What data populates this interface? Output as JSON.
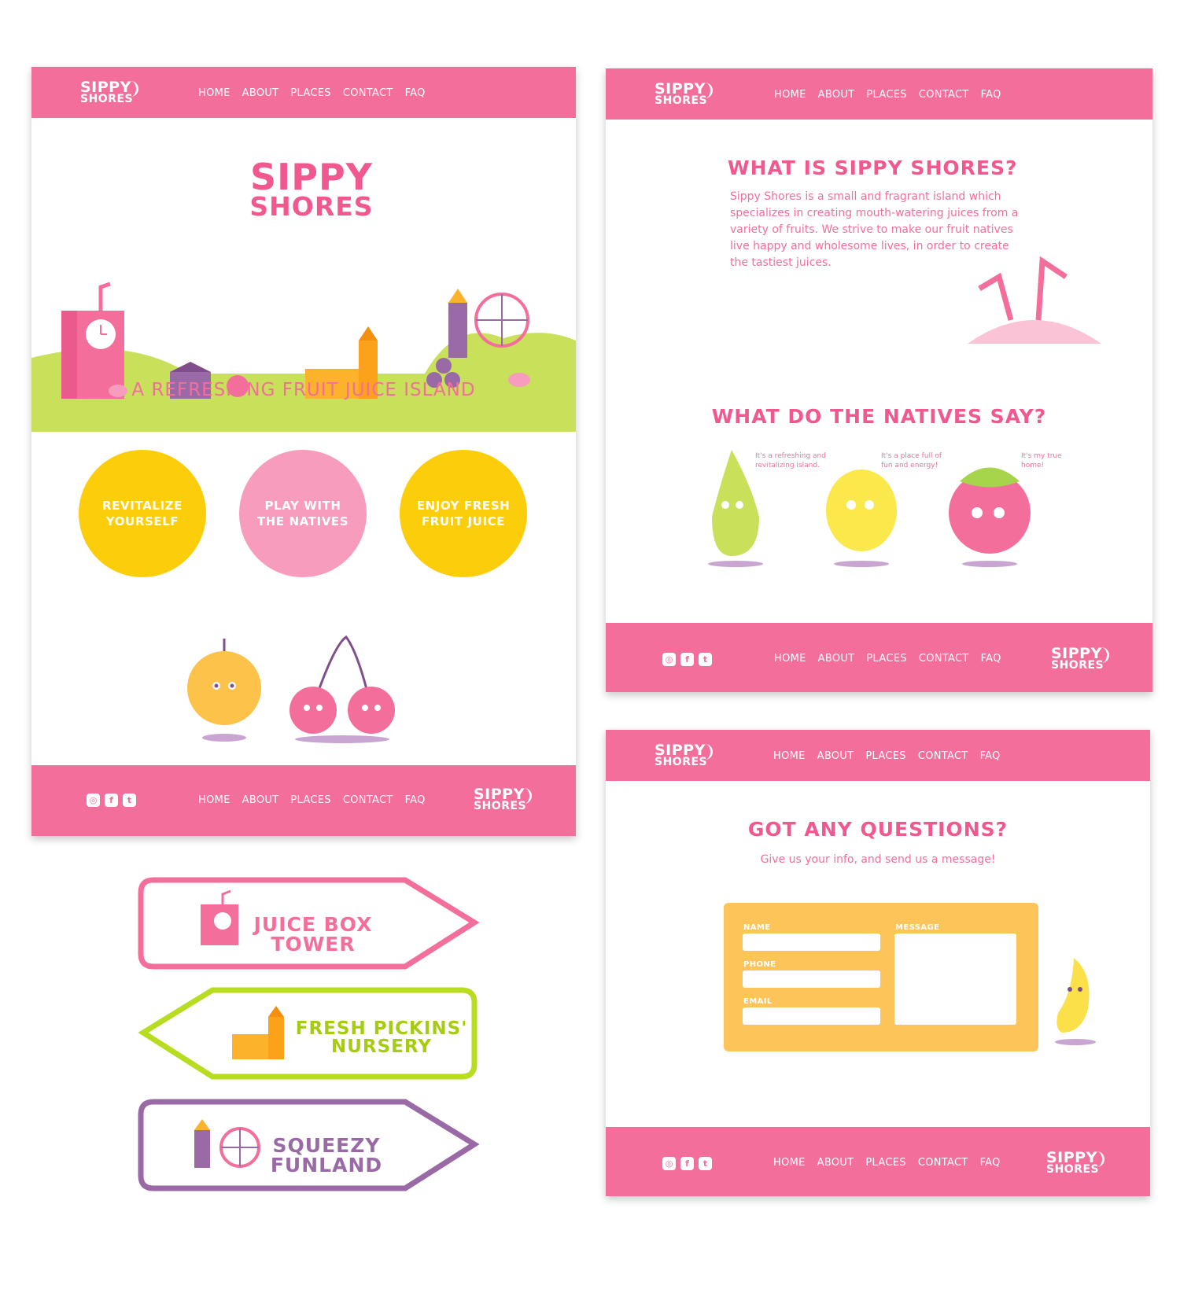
{
  "brand": {
    "line1": "SIPPY",
    "line2": "SHORES"
  },
  "nav": [
    "HOME",
    "ABOUT",
    "PLACES",
    "CONTACT",
    "FAQ"
  ],
  "social": [
    "instagram-icon",
    "facebook-icon",
    "twitter-icon"
  ],
  "social_glyphs": {
    "instagram": "◎",
    "facebook": "f",
    "twitter": "t"
  },
  "home": {
    "tagline": "A REFRESHING FRUIT JUICE ISLAND",
    "circles": [
      {
        "label": "REVITALIZE YOURSELF",
        "color": "#fccd0a"
      },
      {
        "label": "PLAY WITH THE NATIVES",
        "color": "#f79cbc"
      },
      {
        "label": "ENJOY FRESH FRUIT JUICE",
        "color": "#fccd0a"
      }
    ]
  },
  "about": {
    "title": "WHAT IS SIPPY SHORES?",
    "body": "Sippy Shores is a small and fragrant island which specializes in creating mouth-watering juices from a variety of fruits. We strive to make our fruit natives live happy and wholesome lives, in order to create the tastiest juices.",
    "natives_title": "WHAT DO THE NATIVES SAY?",
    "quotes": [
      "It's a refreshing and revitalizing island.",
      "It's a place full of fun and energy!",
      "It's my true home!"
    ]
  },
  "contact": {
    "title": "GOT ANY QUESTIONS?",
    "subtitle": "Give us your info, and send us a message!",
    "labels": {
      "name": "NAME",
      "phone": "PHONE",
      "email": "EMAIL",
      "message": "MESSAGE"
    }
  },
  "signs": [
    {
      "line1": "JUICE BOX",
      "line2": "TOWER",
      "color": "#f46e9c"
    },
    {
      "line1": "FRESH PICKINS'",
      "line2": "NURSERY",
      "color": "#b7dc20"
    },
    {
      "line1": "SQUEEZY",
      "line2": "FUNLAND",
      "color": "#9a6aa6"
    }
  ],
  "colors": {
    "pink": "#f46e9c",
    "title_pink": "#f0588f",
    "yellow": "#fccd0a",
    "green": "#c8e05a",
    "purple": "#9a6aa6",
    "form_yellow": "#fdc45a"
  }
}
